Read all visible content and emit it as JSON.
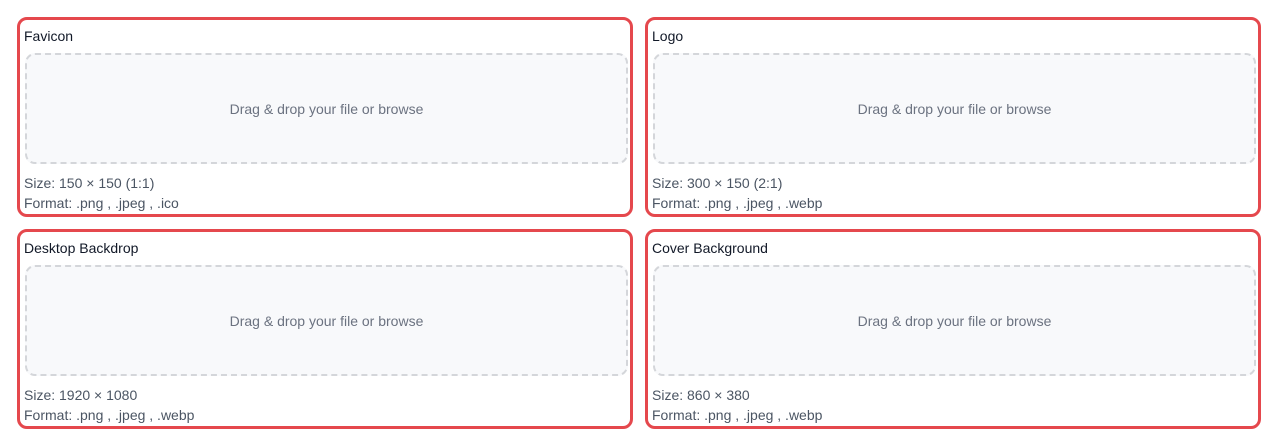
{
  "uploads": [
    {
      "title": "Favicon",
      "dropzone_text": "Drag & drop your file or browse",
      "size_text": "Size: 150 × 150 (1:1)",
      "format_text": "Format: .png , .jpeg , .ico"
    },
    {
      "title": "Logo",
      "dropzone_text": "Drag & drop your file or browse",
      "size_text": "Size: 300 × 150 (2:1)",
      "format_text": "Format: .png , .jpeg , .webp"
    },
    {
      "title": "Desktop Backdrop",
      "dropzone_text": "Drag & drop your file or browse",
      "size_text": "Size: 1920 × 1080",
      "format_text": "Format: .png , .jpeg , .webp"
    },
    {
      "title": "Cover Background",
      "dropzone_text": "Drag & drop your file or browse",
      "size_text": "Size: 860 × 380",
      "format_text": "Format: .png , .jpeg , .webp"
    }
  ],
  "colors": {
    "card_border": "#e5484d",
    "dropzone_border": "#d4d6da",
    "dropzone_bg": "#f8f9fb",
    "muted_text": "#6b7280"
  }
}
